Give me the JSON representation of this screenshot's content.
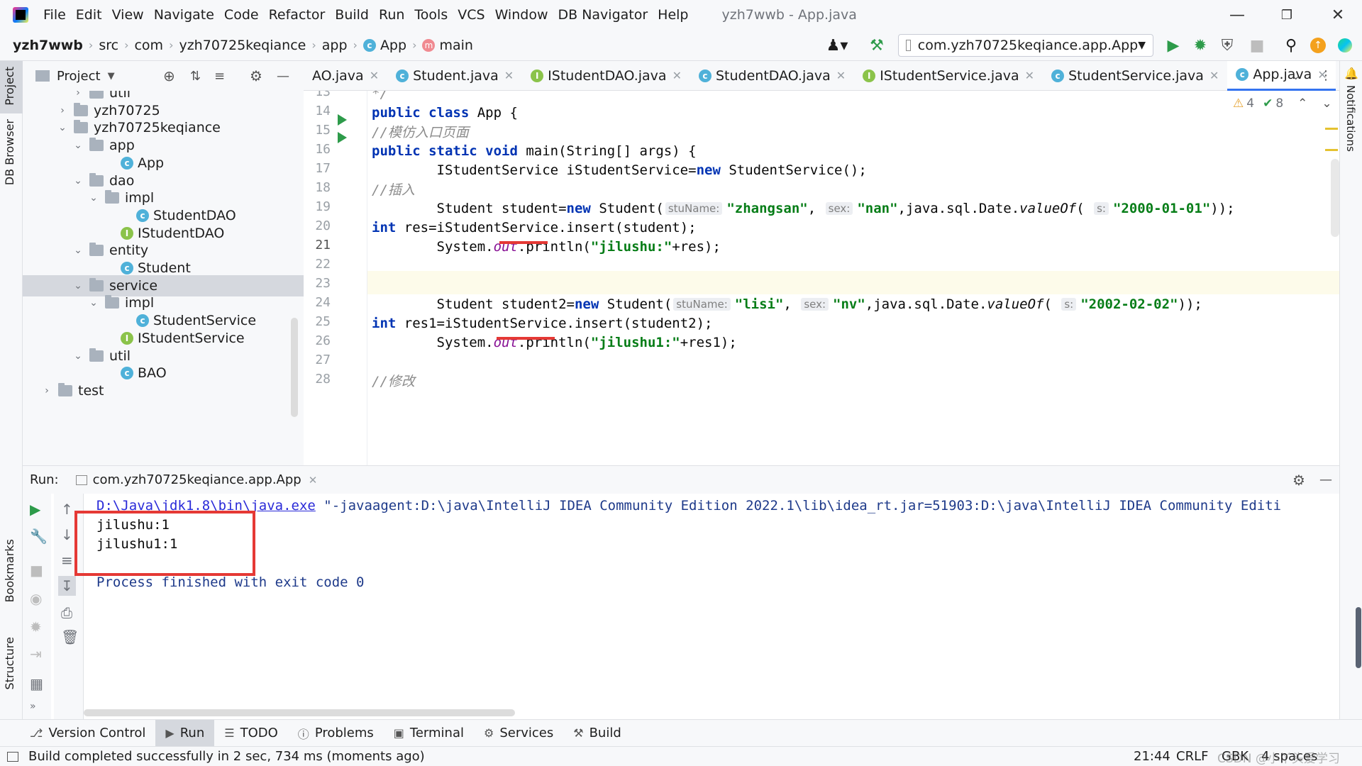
{
  "menu": {
    "items": [
      "File",
      "Edit",
      "View",
      "Navigate",
      "Code",
      "Refactor",
      "Build",
      "Run",
      "Tools",
      "VCS",
      "Window",
      "DB Navigator",
      "Help"
    ],
    "window_title": "yzh7wwb - App.java"
  },
  "breadcrumbs": [
    "yzh7wwb",
    "src",
    "com",
    "yzh70725keqiance",
    "app",
    "App",
    "main"
  ],
  "run_config": "com.yzh70725keqiance.app.App",
  "left_stripe": {
    "project": "Project",
    "db_browser": "DB Browser",
    "bookmarks": "Bookmarks",
    "structure": "Structure"
  },
  "right_stripe": {
    "notifications": "Notifications"
  },
  "project_panel": {
    "title": "Project",
    "tree": [
      {
        "label": "util",
        "depth": 4,
        "arrow": ">",
        "kind": "folder"
      },
      {
        "label": "yzh70725",
        "depth": 3,
        "arrow": ">",
        "kind": "folder"
      },
      {
        "label": "yzh70725keqiance",
        "depth": 3,
        "arrow": "v",
        "kind": "folder"
      },
      {
        "label": "app",
        "depth": 4,
        "arrow": "v",
        "kind": "folder"
      },
      {
        "label": "App",
        "depth": 6,
        "arrow": "",
        "kind": "class"
      },
      {
        "label": "dao",
        "depth": 4,
        "arrow": "v",
        "kind": "folder"
      },
      {
        "label": "impl",
        "depth": 5,
        "arrow": "v",
        "kind": "folder"
      },
      {
        "label": "StudentDAO",
        "depth": 7,
        "arrow": "",
        "kind": "class"
      },
      {
        "label": "IStudentDAO",
        "depth": 6,
        "arrow": "",
        "kind": "interface"
      },
      {
        "label": "entity",
        "depth": 4,
        "arrow": "v",
        "kind": "folder"
      },
      {
        "label": "Student",
        "depth": 6,
        "arrow": "",
        "kind": "class"
      },
      {
        "label": "service",
        "depth": 4,
        "arrow": "v",
        "kind": "folder",
        "selected": true
      },
      {
        "label": "impl",
        "depth": 5,
        "arrow": "v",
        "kind": "folder"
      },
      {
        "label": "StudentService",
        "depth": 7,
        "arrow": "",
        "kind": "class"
      },
      {
        "label": "IStudentService",
        "depth": 6,
        "arrow": "",
        "kind": "interface"
      },
      {
        "label": "util",
        "depth": 4,
        "arrow": "v",
        "kind": "folder"
      },
      {
        "label": "BAO",
        "depth": 6,
        "arrow": "",
        "kind": "class"
      },
      {
        "label": "test",
        "depth": 2,
        "arrow": ">",
        "kind": "folder"
      }
    ]
  },
  "editor_tabs": [
    {
      "label": "AO.java",
      "kind": "class"
    },
    {
      "label": "Student.java",
      "kind": "class"
    },
    {
      "label": "IStudentDAO.java",
      "kind": "interface"
    },
    {
      "label": "StudentDAO.java",
      "kind": "class"
    },
    {
      "label": "IStudentService.java",
      "kind": "interface"
    },
    {
      "label": "StudentService.java",
      "kind": "class"
    },
    {
      "label": "App.java",
      "kind": "class",
      "active": true
    }
  ],
  "editor": {
    "warnings": "4",
    "weak_warnings": "8",
    "line_numbers": [
      "13",
      "14",
      "15",
      "16",
      "17",
      "18",
      "19",
      "20",
      "21",
      "22",
      "23",
      "24",
      "25",
      "26",
      "27",
      "28"
    ],
    "current_line": "21"
  },
  "run_panel": {
    "label": "Run:",
    "tab": "com.yzh70725keqiance.app.App",
    "cmd_path": "D:\\Java\\jdk1.8\\bin\\java.exe",
    "cmd_args": " \"-javaagent:D:\\java\\IntelliJ IDEA Community Edition 2022.1\\lib\\idea_rt.jar=51903:D:\\java\\IntelliJ IDEA Community Editi",
    "output": [
      "jilushu:1",
      "jilushu1:1"
    ],
    "exit": "Process finished with exit code 0"
  },
  "bottom_tools": [
    "Version Control",
    "Run",
    "TODO",
    "Problems",
    "Terminal",
    "Services",
    "Build"
  ],
  "status": {
    "message": "Build completed successfully in 2 sec, 734 ms (moments ago)",
    "position": "21:44",
    "line_sep": "CRLF",
    "encoding": "GBK",
    "indent": "4 spaces",
    "watermark": "CSDN @小丫头爱学习"
  },
  "colors": {
    "accent": "#3574f0",
    "keyword": "#0033b3",
    "string": "#067d17",
    "highlight_box": "#e53935"
  }
}
